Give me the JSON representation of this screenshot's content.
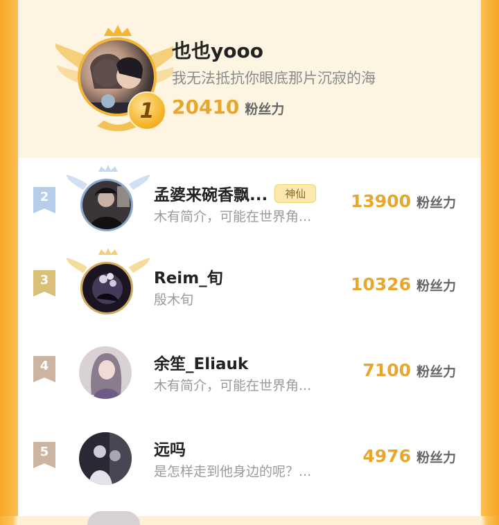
{
  "top": {
    "rank": "1",
    "name": "也也yooo",
    "signature": "我无法抵抗你眼底那片沉寂的海",
    "score": "20410",
    "score_unit": "粉丝力"
  },
  "list": [
    {
      "rank": "2",
      "name": "孟婆来碗香飘...",
      "badge": "神仙",
      "desc": "木有简介，可能在世界角...",
      "score": "13900",
      "unit": "粉丝力"
    },
    {
      "rank": "3",
      "name": "Reim_旬",
      "desc": "殷木旬",
      "score": "10326",
      "unit": "粉丝力"
    },
    {
      "rank": "4",
      "name": "余笙_Eliauk",
      "desc": "木有简介，可能在世界角...",
      "score": "7100",
      "unit": "粉丝力"
    },
    {
      "rank": "5",
      "name": "远吗",
      "desc": "是怎样走到他身边的呢？...",
      "score": "4976",
      "unit": "粉丝力"
    }
  ],
  "colors": {
    "accent": "#e9a62c",
    "rank2": "#b6cdea",
    "rank3": "#d9bf78",
    "rank4": "#cbb5a2",
    "rank5": "#cbb5a2"
  }
}
